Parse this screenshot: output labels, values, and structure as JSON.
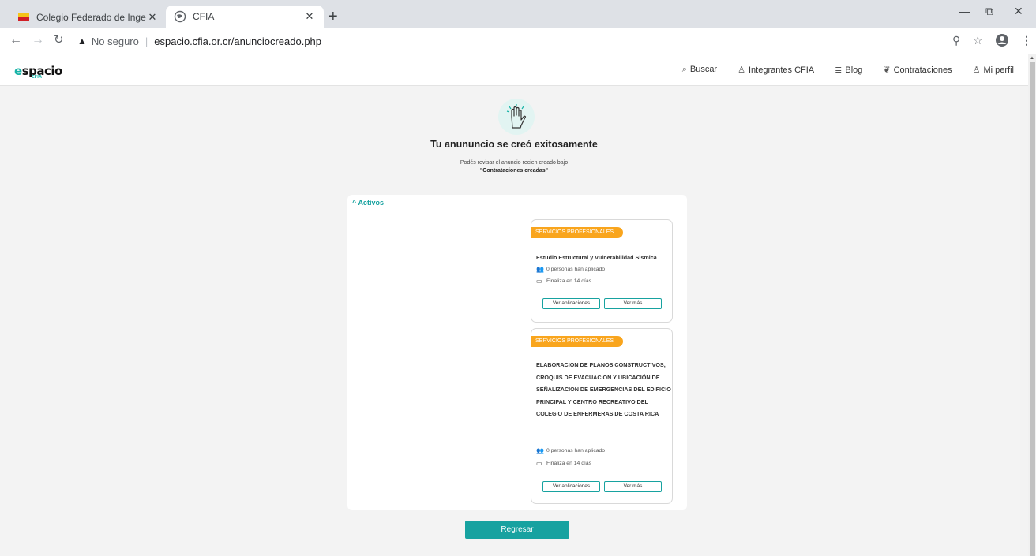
{
  "browser": {
    "tabs": [
      {
        "title": "Colegio Federado de Ingenieros"
      },
      {
        "title": "CFIA"
      }
    ],
    "new_tab": "+",
    "window_controls": {
      "minimize": "—",
      "restore": "⧉",
      "close": "✕"
    },
    "address_bar": {
      "security_label": "No seguro",
      "url": "espacio.cfia.or.cr/anunciocreado.php"
    }
  },
  "site": {
    "logo": {
      "text_accent": "e",
      "text_rest": "spacio",
      "sub": "CFIA"
    },
    "nav": [
      {
        "icon": "search-icon",
        "label": "Buscar"
      },
      {
        "icon": "members-icon",
        "label": "Integrantes CFIA"
      },
      {
        "icon": "blog-icon",
        "label": "Blog"
      },
      {
        "icon": "leaf-icon",
        "label": "Contrataciones"
      },
      {
        "icon": "user-icon",
        "label": "Mi perfil"
      }
    ]
  },
  "main": {
    "title": "Tu anununcio se creó exitosamente",
    "subtitle_line1": "Podés revisar el anuncio recien creado bajo",
    "subtitle_line2": "\"Contrataciones creadas\"",
    "section_label": "Activos",
    "cards": [
      {
        "badge": "SERVICIOS PROFESIONALES",
        "title": "Estudio Estructural y Vulnerabilidad Sismica",
        "applicants": "0 personas han aplicado",
        "ends": "Finaliza en 14 días",
        "btn_applications": "Ver aplicaciones",
        "btn_more": "Ver más"
      },
      {
        "badge": "SERVICIOS PROFESIONALES",
        "title": "ELABORACION DE PLANOS CONSTRUCTIVOS, CROQUIS DE EVACUACION Y UBICACIÓN DE SEÑALIZACION DE EMERGENCIAS DEL EDIFICIO PRINCIPAL Y CENTRO RECREATIVO DEL COLEGIO DE ENFERMERAS DE COSTA RICA",
        "applicants": "0 personas han aplicado",
        "ends": "Finaliza en 14 días",
        "btn_applications": "Ver aplicaciones",
        "btn_more": "Ver más"
      }
    ],
    "back_button": "Regresar"
  },
  "colors": {
    "accent": "#17a2a0",
    "badge": "#f9a51d"
  }
}
